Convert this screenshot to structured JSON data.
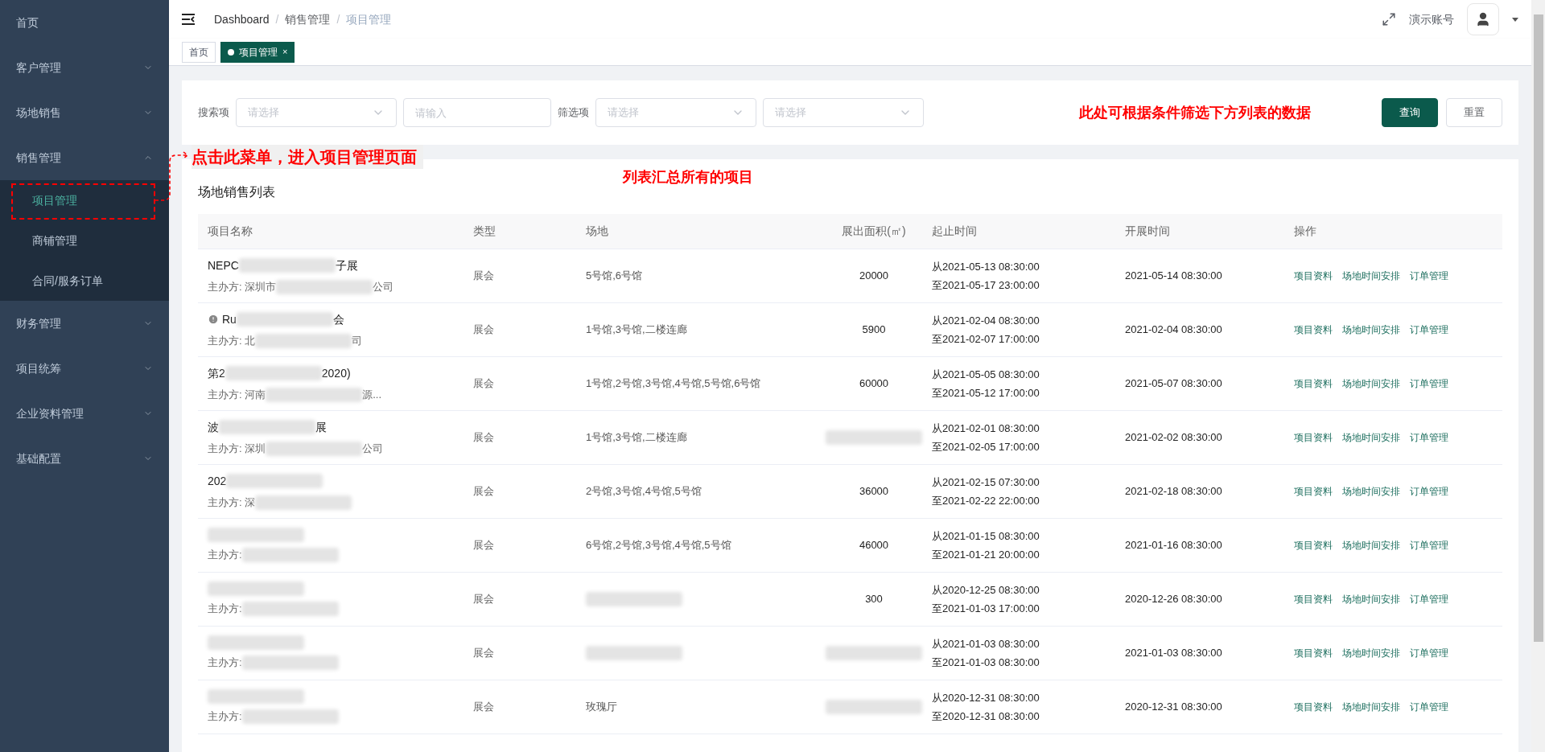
{
  "sidebar": {
    "items": [
      {
        "label": "首页",
        "kind": "link",
        "selected": false
      },
      {
        "label": "客户管理",
        "kind": "submenu",
        "expanded": false,
        "selected": false
      },
      {
        "label": "场地销售",
        "kind": "submenu",
        "expanded": false,
        "selected": false
      },
      {
        "label": "销售管理",
        "kind": "submenu",
        "expanded": true,
        "selected": false,
        "children": [
          {
            "label": "项目管理",
            "selected": true
          },
          {
            "label": "商铺管理",
            "selected": false
          },
          {
            "label": "合同/服务订单",
            "selected": false
          }
        ]
      },
      {
        "label": "财务管理",
        "kind": "submenu",
        "expanded": false,
        "selected": false
      },
      {
        "label": "项目统筹",
        "kind": "submenu",
        "expanded": false,
        "selected": false
      },
      {
        "label": "企业资料管理",
        "kind": "submenu",
        "expanded": false,
        "selected": false
      },
      {
        "label": "基础配置",
        "kind": "submenu",
        "expanded": false,
        "selected": false
      }
    ],
    "note": "点击此菜单，进入项目管理页面"
  },
  "header": {
    "breadcrumb": [
      "Dashboard",
      "销售管理",
      "项目管理"
    ],
    "separator": "/",
    "user": "演示账号"
  },
  "tabs": [
    {
      "label": "首页",
      "selected": false
    },
    {
      "label": "项目管理",
      "selected": true,
      "close": "×"
    }
  ],
  "filter": {
    "search_label": "搜索项",
    "search_select": {
      "placeholder": "请选择"
    },
    "search_input": {
      "placeholder": "请输入"
    },
    "filter_label": "筛选项",
    "filter_selects": [
      {
        "placeholder": "请选择"
      },
      {
        "placeholder": "请选择"
      }
    ],
    "note": "此处可根据条件筛选下方列表的数据",
    "buttons": [
      {
        "label": "查询",
        "kind": "primary"
      },
      {
        "label": "重置",
        "kind": "default"
      }
    ]
  },
  "table": {
    "title": "场地销售列表",
    "note": "列表汇总所有的项目",
    "columns": [
      "项目名称",
      "类型",
      "场地",
      "展出面积(㎡)",
      "起止时间",
      "开展时间",
      "操作"
    ],
    "rows": [
      {
        "warning": false,
        "name": [
          {
            "kind": "text",
            "text": "NEPC"
          },
          {
            "kind": "blur"
          },
          {
            "kind": "text",
            "text": "子展"
          }
        ],
        "organizer": [
          {
            "kind": "text",
            "text": "主办方: 深圳市"
          },
          {
            "kind": "blur"
          },
          {
            "kind": "text",
            "text": "公司"
          }
        ],
        "type": "展会",
        "venue": [
          {
            "kind": "text",
            "text": "5号馆,6号馆"
          }
        ],
        "area": [
          {
            "kind": "text",
            "text": "20000"
          }
        ],
        "start": "从2021-05-13 08:30:00",
        "end": "至2021-05-17 23:00:00",
        "open_time": "2021-05-14 08:30:00",
        "actions": [
          "项目资料",
          "场地时间安排",
          "订单管理"
        ]
      },
      {
        "warning": true,
        "name": [
          {
            "kind": "text",
            "text": "Ru"
          },
          {
            "kind": "blur"
          },
          {
            "kind": "text",
            "text": "会"
          }
        ],
        "organizer": [
          {
            "kind": "text",
            "text": "主办方: 北"
          },
          {
            "kind": "blur"
          },
          {
            "kind": "text",
            "text": "司"
          }
        ],
        "type": "展会",
        "venue": [
          {
            "kind": "text",
            "text": "1号馆,3号馆,二楼连廊"
          }
        ],
        "area": [
          {
            "kind": "text",
            "text": "5900"
          }
        ],
        "start": "从2021-02-04 08:30:00",
        "end": "至2021-02-07 17:00:00",
        "open_time": "2021-02-04 08:30:00",
        "actions": [
          "项目资料",
          "场地时间安排",
          "订单管理"
        ]
      },
      {
        "warning": false,
        "name": [
          {
            "kind": "text",
            "text": "第2"
          },
          {
            "kind": "blur"
          },
          {
            "kind": "text",
            "text": "2020)"
          }
        ],
        "organizer": [
          {
            "kind": "text",
            "text": "主办方: 河南"
          },
          {
            "kind": "blur"
          },
          {
            "kind": "text",
            "text": "源..."
          }
        ],
        "type": "展会",
        "venue": [
          {
            "kind": "text",
            "text": "1号馆,2号馆,3号馆,4号馆,5号馆,6号馆"
          }
        ],
        "area": [
          {
            "kind": "text",
            "text": "60000"
          }
        ],
        "start": "从2021-05-05 08:30:00",
        "end": "至2021-05-12 17:00:00",
        "open_time": "2021-05-07 08:30:00",
        "actions": [
          "项目资料",
          "场地时间安排",
          "订单管理"
        ]
      },
      {
        "warning": false,
        "name": [
          {
            "kind": "text",
            "text": "波"
          },
          {
            "kind": "blur"
          },
          {
            "kind": "text",
            "text": "展"
          }
        ],
        "organizer": [
          {
            "kind": "text",
            "text": "主办方: 深圳"
          },
          {
            "kind": "blur"
          },
          {
            "kind": "text",
            "text": "公司"
          }
        ],
        "type": "展会",
        "venue": [
          {
            "kind": "text",
            "text": "1号馆,3号馆,二楼连廊"
          }
        ],
        "area": [
          {
            "kind": "blur"
          }
        ],
        "start": "从2021-02-01 08:30:00",
        "end": "至2021-02-05 17:00:00",
        "open_time": "2021-02-02 08:30:00",
        "actions": [
          "项目资料",
          "场地时间安排",
          "订单管理"
        ]
      },
      {
        "warning": false,
        "name": [
          {
            "kind": "text",
            "text": "202"
          },
          {
            "kind": "blur"
          }
        ],
        "organizer": [
          {
            "kind": "text",
            "text": "主办方: 深"
          },
          {
            "kind": "blur"
          }
        ],
        "type": "展会",
        "venue": [
          {
            "kind": "text",
            "text": "2号馆,3号馆,4号馆,5号馆"
          }
        ],
        "area": [
          {
            "kind": "text",
            "text": "36000"
          }
        ],
        "start": "从2021-02-15 07:30:00",
        "end": "至2021-02-22 22:00:00",
        "open_time": "2021-02-18 08:30:00",
        "actions": [
          "项目资料",
          "场地时间安排",
          "订单管理"
        ]
      },
      {
        "warning": false,
        "name": [
          {
            "kind": "blur"
          }
        ],
        "organizer": [
          {
            "kind": "text",
            "text": "主办方:"
          },
          {
            "kind": "blur"
          }
        ],
        "type": "展会",
        "venue": [
          {
            "kind": "text",
            "text": "6号馆,2号馆,3号馆,4号馆,5号馆"
          }
        ],
        "area": [
          {
            "kind": "text",
            "text": "46000"
          }
        ],
        "start": "从2021-01-15 08:30:00",
        "end": "至2021-01-21 20:00:00",
        "open_time": "2021-01-16 08:30:00",
        "actions": [
          "项目资料",
          "场地时间安排",
          "订单管理"
        ]
      },
      {
        "warning": false,
        "name": [
          {
            "kind": "blur"
          }
        ],
        "organizer": [
          {
            "kind": "text",
            "text": "主办方:"
          },
          {
            "kind": "blur"
          }
        ],
        "type": "展会",
        "venue": [
          {
            "kind": "blur"
          }
        ],
        "area": [
          {
            "kind": "text",
            "text": "300"
          }
        ],
        "start": "从2020-12-25 08:30:00",
        "end": "至2021-01-03 17:00:00",
        "open_time": "2020-12-26 08:30:00",
        "actions": [
          "项目资料",
          "场地时间安排",
          "订单管理"
        ]
      },
      {
        "warning": false,
        "name": [
          {
            "kind": "blur"
          }
        ],
        "organizer": [
          {
            "kind": "text",
            "text": "主办方:"
          },
          {
            "kind": "blur"
          }
        ],
        "type": "展会",
        "venue": [
          {
            "kind": "blur"
          }
        ],
        "area": [
          {
            "kind": "blur"
          }
        ],
        "start": "从2021-01-03 08:30:00",
        "end": "至2021-01-03 08:30:00",
        "open_time": "2021-01-03 08:30:00",
        "actions": [
          "项目资料",
          "场地时间安排",
          "订单管理"
        ]
      },
      {
        "warning": false,
        "name": [
          {
            "kind": "blur"
          }
        ],
        "organizer": [
          {
            "kind": "text",
            "text": "主办方:"
          },
          {
            "kind": "blur"
          }
        ],
        "type": "展会",
        "venue": [
          {
            "kind": "text",
            "text": "玫瑰厅"
          }
        ],
        "area": [
          {
            "kind": "blur"
          }
        ],
        "start": "从2020-12-31 08:30:00",
        "end": "至2020-12-31 08:30:00",
        "open_time": "2020-12-31 08:30:00",
        "actions": [
          "项目资料",
          "场地时间安排",
          "订单管理"
        ]
      }
    ]
  }
}
